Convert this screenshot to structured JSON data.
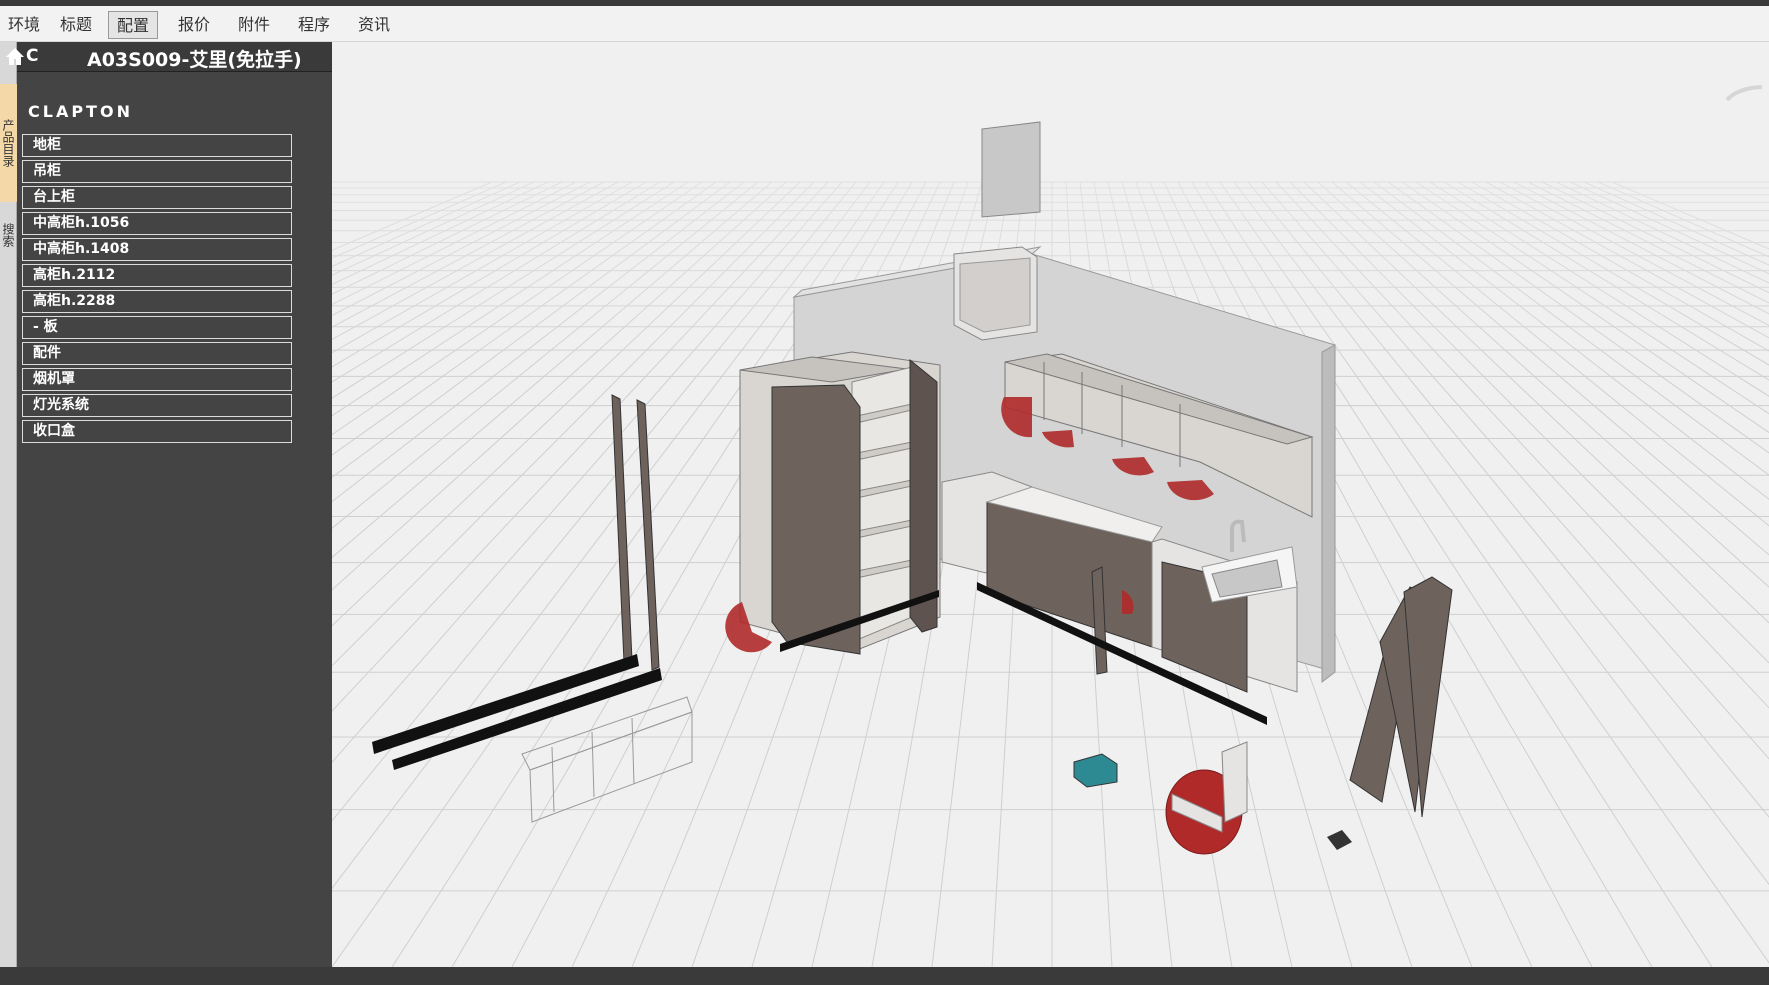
{
  "menubar": {
    "tabs": [
      {
        "label": "环境"
      },
      {
        "label": "标题"
      },
      {
        "label": "配置",
        "active": true
      },
      {
        "label": "报价"
      },
      {
        "label": "附件"
      },
      {
        "label": "程序"
      },
      {
        "label": "资讯"
      }
    ]
  },
  "sidebar": {
    "vertical_tabs": [
      {
        "label": "产品目录",
        "active": true
      },
      {
        "label": "搜索"
      }
    ],
    "back_label": "C",
    "category_title": "A03S009-艾里(免拉手)",
    "brand": "CLAPTON",
    "items": [
      {
        "label": "地柜"
      },
      {
        "label": "吊柜"
      },
      {
        "label": "台上柜"
      },
      {
        "label": "中高柜h.1056"
      },
      {
        "label": "中高柜h.1408"
      },
      {
        "label": "高柜h.2112"
      },
      {
        "label": "高柜h.2288"
      },
      {
        "label": "- 板"
      },
      {
        "label": "配件"
      },
      {
        "label": "烟机罩"
      },
      {
        "label": "灯光系统"
      },
      {
        "label": "收口盒"
      }
    ]
  },
  "viewport": {
    "scene": "3d-kitchen-exploded-view",
    "colors": {
      "background": "#f0f0f0",
      "grid": "#cfcfcf",
      "wall": "#d4d4d4",
      "cabinet_light": "#d9d6d2",
      "cabinet_dark": "#6e625d",
      "door_open_marker": "#b02a2a",
      "plinth": "#111111"
    }
  }
}
